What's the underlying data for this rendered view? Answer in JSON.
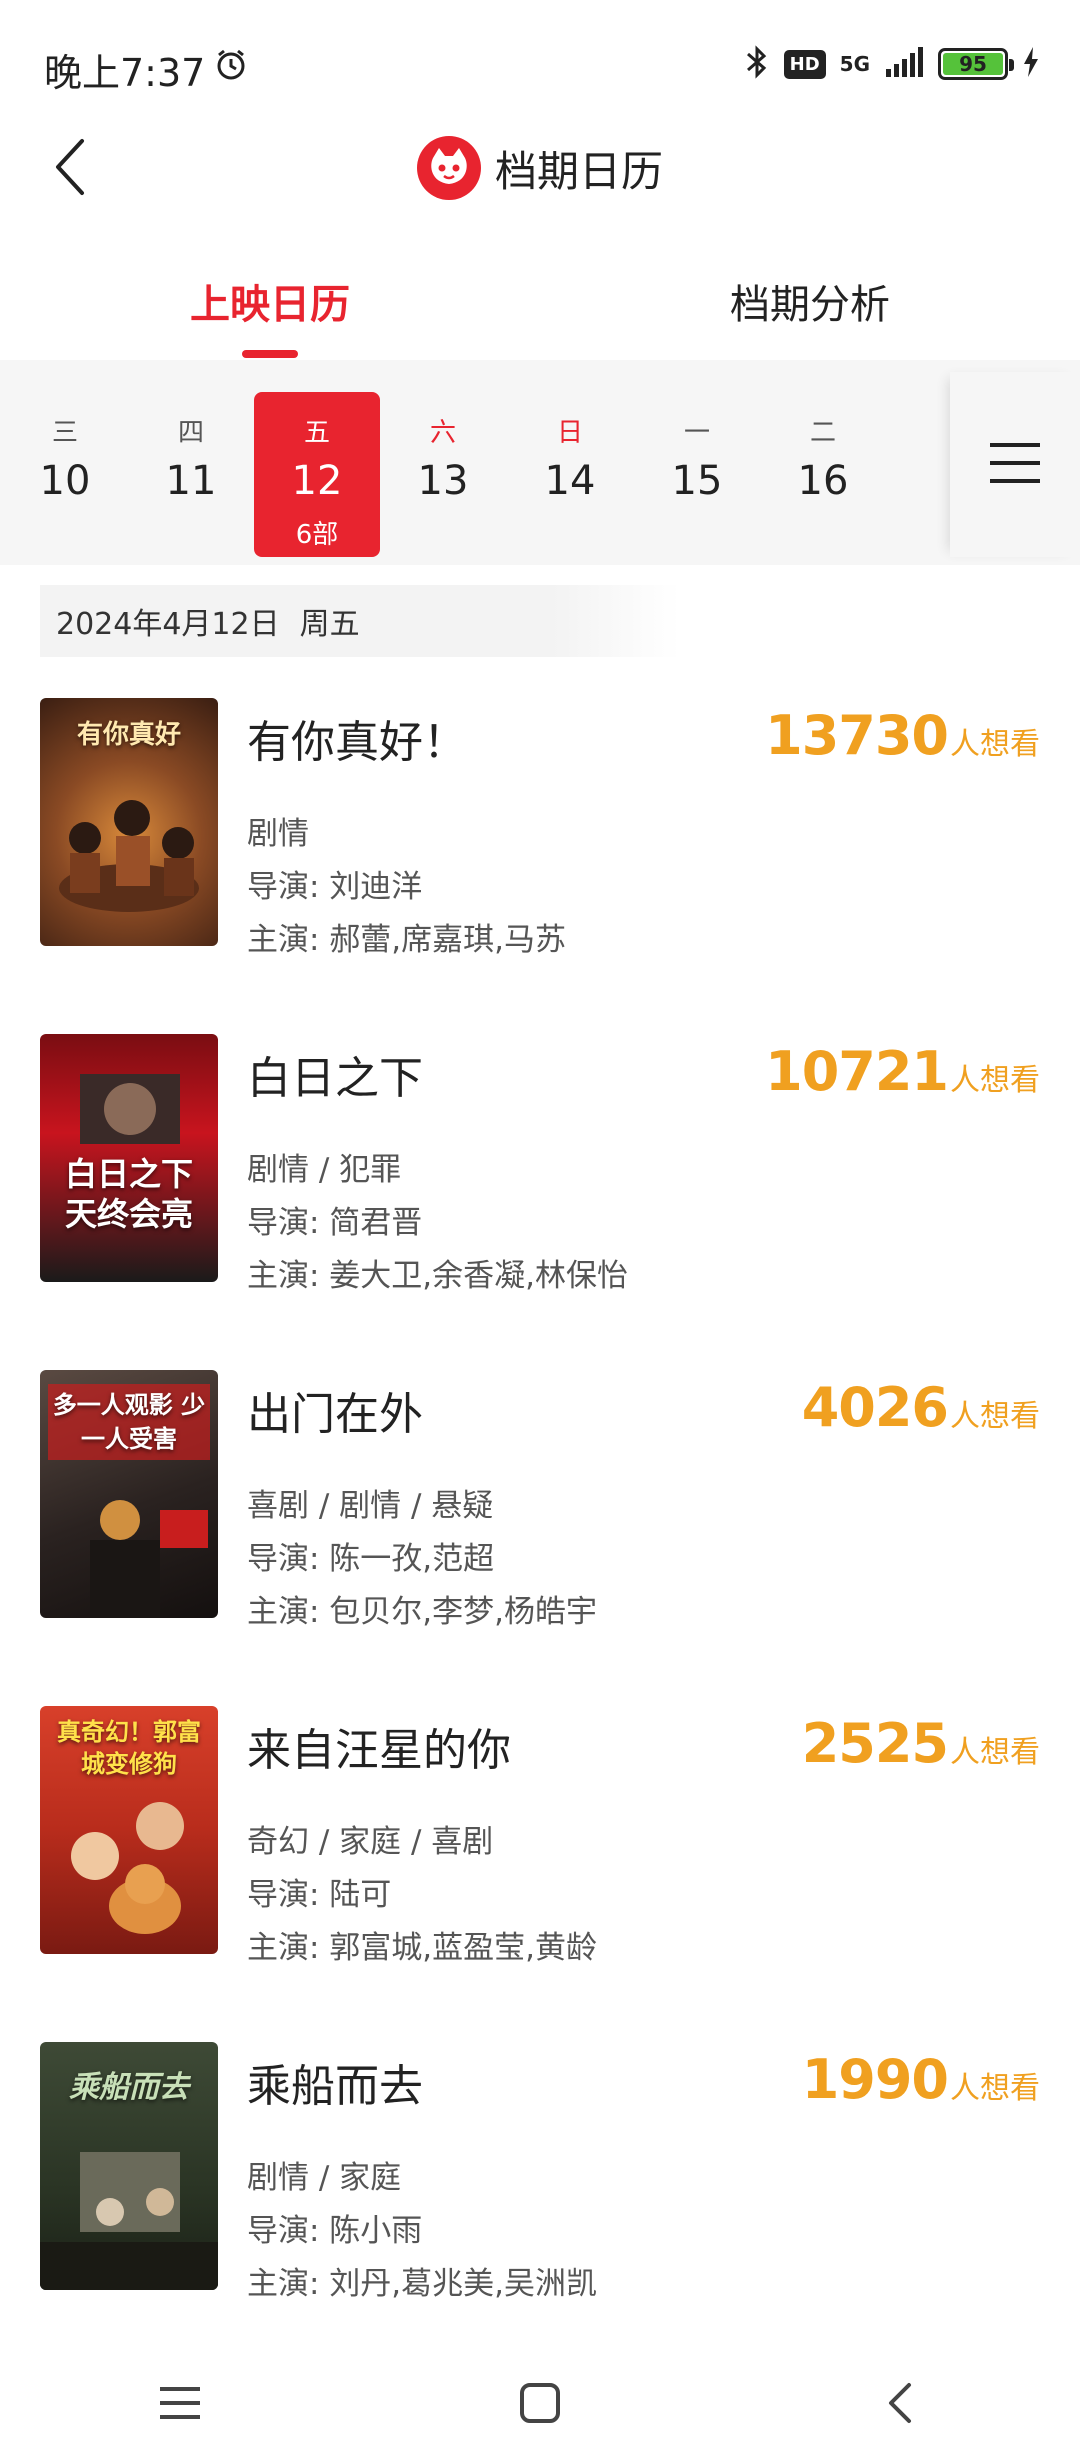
{
  "status_bar": {
    "time": "晚上7:37",
    "hd": "HD",
    "network": "5G",
    "battery": "95",
    "icons": [
      "alarm-icon",
      "bluetooth-icon",
      "signal-icon",
      "charging-icon"
    ]
  },
  "header": {
    "title": "档期日历",
    "icons": [
      "back-arrow-icon",
      "maoyan-cat-logo"
    ]
  },
  "tabs": [
    {
      "label": "上映日历",
      "active": true
    },
    {
      "label": "档期分析",
      "active": false
    }
  ],
  "date_strip": {
    "days": [
      {
        "week": "三",
        "num": "10"
      },
      {
        "week": "四",
        "num": "11"
      },
      {
        "week": "五",
        "num": "12",
        "count": "6部",
        "selected": true
      },
      {
        "week": "六",
        "num": "13",
        "weekend": true
      },
      {
        "week": "日",
        "num": "14",
        "weekend": true
      },
      {
        "week": "一",
        "num": "15"
      },
      {
        "week": "二",
        "num": "16"
      }
    ],
    "menu_icon": "hamburger-menu-icon"
  },
  "date_header": {
    "date": "2024年4月12日",
    "weekday": "周五"
  },
  "want_label": "人想看",
  "movies": [
    {
      "title": "有你真好！",
      "want": "13730",
      "genre": "剧情",
      "director": "导演: 刘迪洋",
      "cast": "主演: 郝蕾,席嘉琪,马苏",
      "poster_text": "有你真好",
      "poster_color": "#6b3b22"
    },
    {
      "title": "白日之下",
      "want": "10721",
      "genre": "剧情 / 犯罪",
      "director": "导演: 简君晋",
      "cast": "主演: 姜大卫,余香凝,林保怡",
      "poster_text": "白日之下 天终会亮",
      "poster_color": "#b3121c"
    },
    {
      "title": "出门在外",
      "want": "4026",
      "genre": "喜剧 / 剧情 / 悬疑",
      "director": "导演: 陈一孜,范超",
      "cast": "主演: 包贝尔,李梦,杨皓宇",
      "poster_text": "多一人观影 少一人受害",
      "poster_color": "#2b2523"
    },
    {
      "title": "来自汪星的你",
      "want": "2525",
      "genre": "奇幻 / 家庭 / 喜剧",
      "director": "导演: 陆可",
      "cast": "主演: 郭富城,蓝盈莹,黄龄",
      "poster_text": "真奇幻！郭富城变修狗",
      "poster_color": "#c23a1e"
    },
    {
      "title": "乘船而去",
      "want": "1990",
      "genre": "剧情 / 家庭",
      "director": "导演: 陈小雨",
      "cast": "主演: 刘丹,葛兆美,吴洲凯",
      "poster_text": "乘船而去",
      "poster_color": "#2e3a2a"
    }
  ],
  "navbar": {
    "icons": [
      "recents-menu-icon",
      "home-square-icon",
      "back-chevron-icon"
    ]
  }
}
